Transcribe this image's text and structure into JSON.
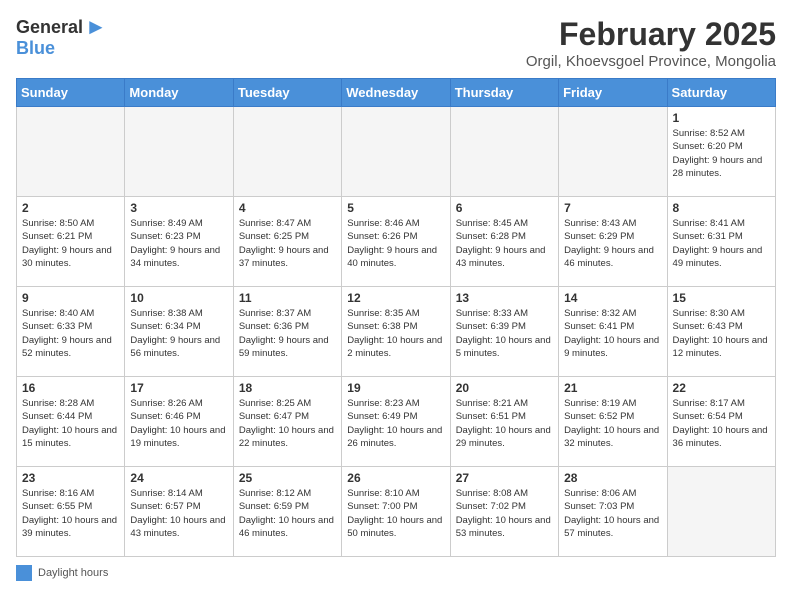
{
  "header": {
    "logo_general": "General",
    "logo_blue": "Blue",
    "title": "February 2025",
    "subtitle": "Orgil, Khoevsgoel Province, Mongolia"
  },
  "weekdays": [
    "Sunday",
    "Monday",
    "Tuesday",
    "Wednesday",
    "Thursday",
    "Friday",
    "Saturday"
  ],
  "legend": {
    "label": "Daylight hours"
  },
  "days": [
    {
      "num": "",
      "info": ""
    },
    {
      "num": "",
      "info": ""
    },
    {
      "num": "",
      "info": ""
    },
    {
      "num": "",
      "info": ""
    },
    {
      "num": "",
      "info": ""
    },
    {
      "num": "",
      "info": ""
    },
    {
      "num": "1",
      "info": "Sunrise: 8:52 AM\nSunset: 6:20 PM\nDaylight: 9 hours and 28 minutes."
    },
    {
      "num": "2",
      "info": "Sunrise: 8:50 AM\nSunset: 6:21 PM\nDaylight: 9 hours and 30 minutes."
    },
    {
      "num": "3",
      "info": "Sunrise: 8:49 AM\nSunset: 6:23 PM\nDaylight: 9 hours and 34 minutes."
    },
    {
      "num": "4",
      "info": "Sunrise: 8:47 AM\nSunset: 6:25 PM\nDaylight: 9 hours and 37 minutes."
    },
    {
      "num": "5",
      "info": "Sunrise: 8:46 AM\nSunset: 6:26 PM\nDaylight: 9 hours and 40 minutes."
    },
    {
      "num": "6",
      "info": "Sunrise: 8:45 AM\nSunset: 6:28 PM\nDaylight: 9 hours and 43 minutes."
    },
    {
      "num": "7",
      "info": "Sunrise: 8:43 AM\nSunset: 6:29 PM\nDaylight: 9 hours and 46 minutes."
    },
    {
      "num": "8",
      "info": "Sunrise: 8:41 AM\nSunset: 6:31 PM\nDaylight: 9 hours and 49 minutes."
    },
    {
      "num": "9",
      "info": "Sunrise: 8:40 AM\nSunset: 6:33 PM\nDaylight: 9 hours and 52 minutes."
    },
    {
      "num": "10",
      "info": "Sunrise: 8:38 AM\nSunset: 6:34 PM\nDaylight: 9 hours and 56 minutes."
    },
    {
      "num": "11",
      "info": "Sunrise: 8:37 AM\nSunset: 6:36 PM\nDaylight: 9 hours and 59 minutes."
    },
    {
      "num": "12",
      "info": "Sunrise: 8:35 AM\nSunset: 6:38 PM\nDaylight: 10 hours and 2 minutes."
    },
    {
      "num": "13",
      "info": "Sunrise: 8:33 AM\nSunset: 6:39 PM\nDaylight: 10 hours and 5 minutes."
    },
    {
      "num": "14",
      "info": "Sunrise: 8:32 AM\nSunset: 6:41 PM\nDaylight: 10 hours and 9 minutes."
    },
    {
      "num": "15",
      "info": "Sunrise: 8:30 AM\nSunset: 6:43 PM\nDaylight: 10 hours and 12 minutes."
    },
    {
      "num": "16",
      "info": "Sunrise: 8:28 AM\nSunset: 6:44 PM\nDaylight: 10 hours and 15 minutes."
    },
    {
      "num": "17",
      "info": "Sunrise: 8:26 AM\nSunset: 6:46 PM\nDaylight: 10 hours and 19 minutes."
    },
    {
      "num": "18",
      "info": "Sunrise: 8:25 AM\nSunset: 6:47 PM\nDaylight: 10 hours and 22 minutes."
    },
    {
      "num": "19",
      "info": "Sunrise: 8:23 AM\nSunset: 6:49 PM\nDaylight: 10 hours and 26 minutes."
    },
    {
      "num": "20",
      "info": "Sunrise: 8:21 AM\nSunset: 6:51 PM\nDaylight: 10 hours and 29 minutes."
    },
    {
      "num": "21",
      "info": "Sunrise: 8:19 AM\nSunset: 6:52 PM\nDaylight: 10 hours and 32 minutes."
    },
    {
      "num": "22",
      "info": "Sunrise: 8:17 AM\nSunset: 6:54 PM\nDaylight: 10 hours and 36 minutes."
    },
    {
      "num": "23",
      "info": "Sunrise: 8:16 AM\nSunset: 6:55 PM\nDaylight: 10 hours and 39 minutes."
    },
    {
      "num": "24",
      "info": "Sunrise: 8:14 AM\nSunset: 6:57 PM\nDaylight: 10 hours and 43 minutes."
    },
    {
      "num": "25",
      "info": "Sunrise: 8:12 AM\nSunset: 6:59 PM\nDaylight: 10 hours and 46 minutes."
    },
    {
      "num": "26",
      "info": "Sunrise: 8:10 AM\nSunset: 7:00 PM\nDaylight: 10 hours and 50 minutes."
    },
    {
      "num": "27",
      "info": "Sunrise: 8:08 AM\nSunset: 7:02 PM\nDaylight: 10 hours and 53 minutes."
    },
    {
      "num": "28",
      "info": "Sunrise: 8:06 AM\nSunset: 7:03 PM\nDaylight: 10 hours and 57 minutes."
    },
    {
      "num": "",
      "info": ""
    }
  ]
}
